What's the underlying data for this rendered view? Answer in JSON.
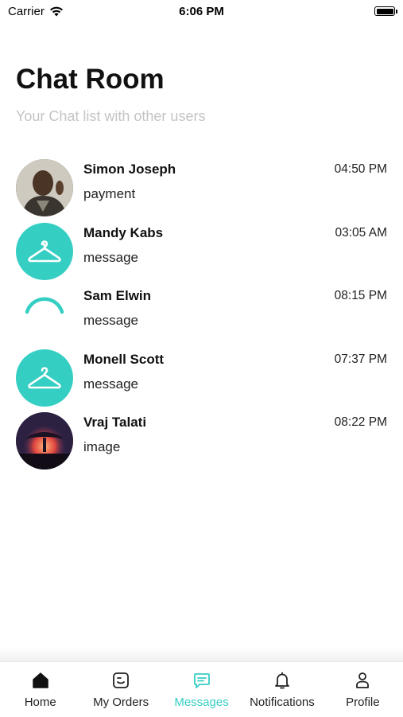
{
  "status_bar": {
    "carrier": "Carrier",
    "time": "6:06 PM"
  },
  "header": {
    "title": "Chat Room",
    "subtitle": "Your Chat list with other users"
  },
  "chats": [
    {
      "name": "Simon Joseph",
      "time": "04:50 PM",
      "preview": "payment",
      "avatar": "person-photo"
    },
    {
      "name": "Mandy Kabs",
      "time": "03:05 AM",
      "preview": "message",
      "avatar": "hanger-icon"
    },
    {
      "name": "Sam Elwin",
      "time": "08:15 PM",
      "preview": "message",
      "avatar": "loading-spinner"
    },
    {
      "name": "Monell Scott",
      "time": "07:37 PM",
      "preview": "message",
      "avatar": "hanger-icon"
    },
    {
      "name": "Vraj Talati",
      "time": "08:22 PM",
      "preview": "image",
      "avatar": "scene-photo"
    }
  ],
  "tabs": [
    {
      "label": "Home",
      "icon": "home-icon"
    },
    {
      "label": "My Orders",
      "icon": "orders-icon"
    },
    {
      "label": "Messages",
      "icon": "messages-icon",
      "active": true
    },
    {
      "label": "Notifications",
      "icon": "bell-icon"
    },
    {
      "label": "Profile",
      "icon": "profile-icon"
    }
  ],
  "colors": {
    "accent": "#35cec3",
    "subtitle": "#c4c4c4"
  }
}
